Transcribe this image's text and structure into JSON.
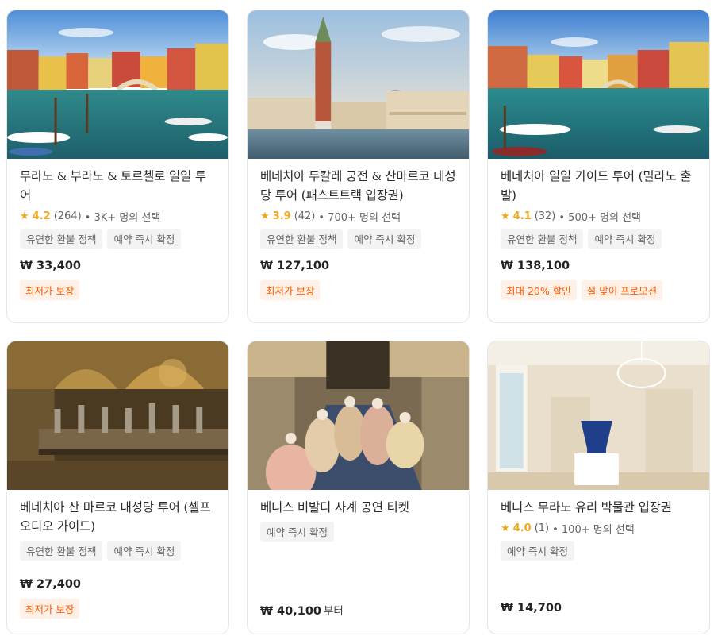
{
  "cards": [
    {
      "title": "무라노 & 부라노 & 토르첼로 일일 투어",
      "rating": "4.2",
      "reviews": "(264)",
      "booked": "• 3K+ 명의 선택",
      "tags": [
        "유연한 환불 정책",
        "예약 즉시 확정"
      ],
      "price": "₩ 33,400",
      "badges": [
        "최저가 보장"
      ]
    },
    {
      "title": "베네치아 두칼레 궁전 & 산마르코 대성당 투어 (패스트트랙 입장권)",
      "rating": "3.9",
      "reviews": "(42)",
      "booked": "• 700+ 명의 선택",
      "tags": [
        "유연한 환불 정책",
        "예약 즉시 확정"
      ],
      "price": "₩ 127,100",
      "badges": [
        "최저가 보장"
      ]
    },
    {
      "title": "베네치아 일일 가이드 투어 (밀라노 출발)",
      "rating": "4.1",
      "reviews": "(32)",
      "booked": "• 500+ 명의 선택",
      "tags": [
        "유연한 환불 정책",
        "예약 즉시 확정"
      ],
      "price": "₩ 138,100",
      "badges": [
        "최대 20% 할인",
        "설 맞이 프로모션"
      ]
    },
    {
      "title": "베네치아 산 마르코 대성당 투어 (셀프 오디오 가이드)",
      "tags": [
        "유연한 환불 정책",
        "예약 즉시 확정"
      ],
      "price": "₩ 27,400",
      "badges": [
        "최저가 보장"
      ]
    },
    {
      "title": "베니스 비발디 사계 공연 티켓",
      "tags": [
        "예약 즉시 확정"
      ],
      "price": "₩ 40,100",
      "price_suffix": "부터"
    },
    {
      "title": "베니스 무라노 유리 박물관 입장권",
      "rating": "4.0",
      "reviews": "(1)",
      "booked": "• 100+ 명의 선택",
      "tags": [
        "예약 즉시 확정"
      ],
      "price": "₩ 14,700"
    }
  ],
  "icons": {
    "rating_star": "star-icon"
  },
  "colors": {
    "star": "#f2a81d",
    "badge_text": "#ff5b00",
    "badge_bg": "#fff1e8",
    "tag_bg": "#f3f3f3"
  }
}
